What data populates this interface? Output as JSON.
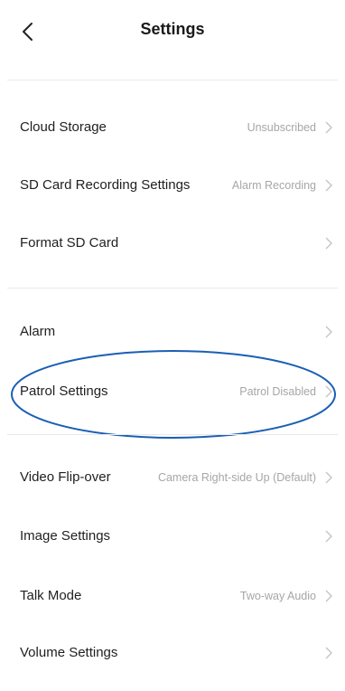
{
  "header": {
    "title": "Settings",
    "back_icon": "chevron-left-icon"
  },
  "settings": {
    "cloud_storage": {
      "label": "Cloud Storage",
      "value": "Unsubscribed"
    },
    "sd_recording": {
      "label": "SD Card Recording Settings",
      "value": "Alarm Recording"
    },
    "format_sd": {
      "label": "Format SD Card",
      "value": ""
    },
    "alarm": {
      "label": "Alarm",
      "value": ""
    },
    "patrol": {
      "label": "Patrol Settings",
      "value": "Patrol Disabled",
      "highlighted": true
    },
    "video_flip": {
      "label": "Video Flip-over",
      "value": "Camera Right-side Up (Default)"
    },
    "image": {
      "label": "Image Settings",
      "value": ""
    },
    "talk_mode": {
      "label": "Talk Mode",
      "value": "Two-way Audio"
    },
    "volume": {
      "label": "Volume Settings",
      "value": ""
    }
  },
  "colors": {
    "highlight_outline": "#1a5fb4",
    "value_text": "#a6a6a6",
    "separator": "#e9e9e9",
    "chevron": "#c4c4c4"
  },
  "icons": {
    "row_chevron": "chevron-right-icon"
  }
}
